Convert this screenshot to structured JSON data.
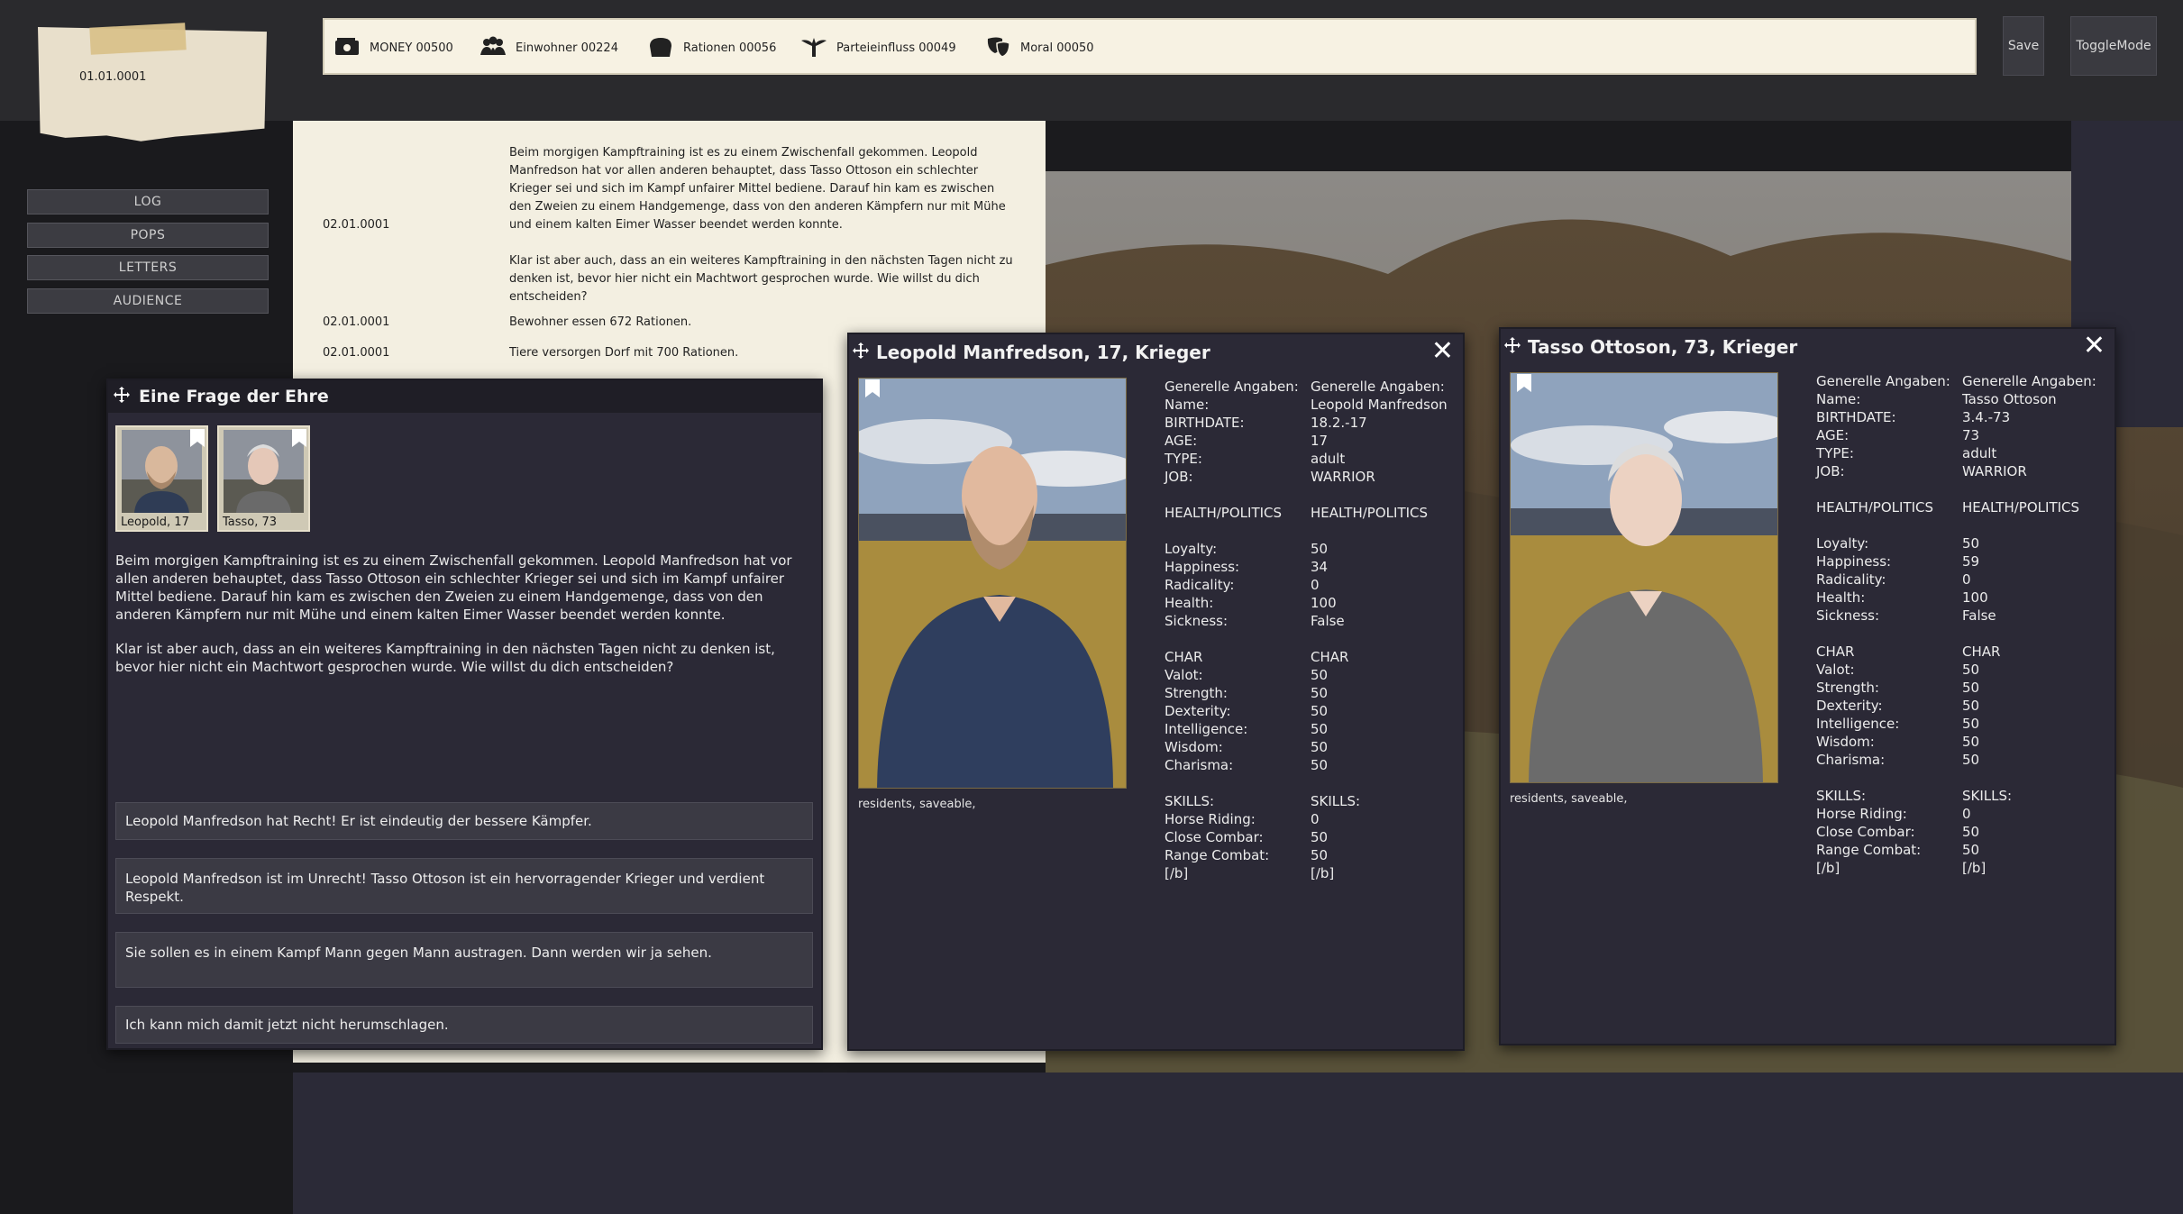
{
  "date": "01.01.0001",
  "resources": {
    "money": "MONEY  00500",
    "einwohner": "Einwohner  00224",
    "rationen": "Rationen  00056",
    "parteieinfluss": "Parteieinfluss  00049",
    "moral": "Moral  00050"
  },
  "buttons": {
    "save": "Save",
    "toggle": "ToggleMode"
  },
  "menu": [
    "LOG",
    "POPS",
    "LETTERS",
    "AUDIENCE"
  ],
  "log": [
    {
      "date": "02.01.0001",
      "text": "Beim morgigen Kampftraining ist es zu einem Zwischenfall gekommen. Leopold Manfredson hat vor allen anderen behauptet, dass Tasso Ottoson ein schlechter Krieger sei und sich im Kampf unfairer Mittel bediene. Darauf hin kam es zwischen den Zweien zu einem Handgemenge, dass von den anderen Kämpfern nur mit Mühe und einem kalten Eimer Wasser beendet werden konnte.",
      "text2": "Klar ist aber auch, dass an ein weiteres Kampftraining in den nächsten Tagen nicht zu denken ist, bevor hier nicht ein Machtwort gesprochen wurde. Wie willst du dich entscheiden?"
    },
    {
      "date": "02.01.0001",
      "text": "Bewohner essen 672 Rationen."
    },
    {
      "date": "02.01.0001",
      "text": "Tiere versorgen Dorf mit 700 Rationen."
    }
  ],
  "event": {
    "title": "Eine Frage der Ehre",
    "portraits": [
      {
        "label": "Leopold, 17"
      },
      {
        "label": "Tasso, 73"
      }
    ],
    "text1": "Beim morgigen Kampftraining ist es zu einem Zwischenfall gekommen. Leopold Manfredson hat vor allen anderen behauptet, dass Tasso Ottoson ein schlechter Krieger sei und sich im Kampf unfairer Mittel bediene. Darauf hin kam es zwischen den Zweien zu einem Handgemenge, dass von den anderen Kämpfern nur mit Mühe und einem kalten Eimer Wasser beendet werden konnte.",
    "text2": "Klar ist aber auch, dass an ein weiteres Kampftraining in den nächsten Tagen nicht zu denken ist, bevor hier nicht ein Machtwort gesprochen wurde. Wie willst du dich entscheiden?",
    "choices": [
      "Leopold Manfredson hat Recht! Er ist eindeutig der bessere Kämpfer.",
      "Leopold Manfredson  ist im Unrecht! Tasso Ottoson ist ein hervorragender Krieger und verdient Respekt.",
      "Sie sollen es in einem Kampf Mann gegen Mann austragen. Dann werden wir ja sehen.",
      "Ich kann mich damit jetzt nicht herumschlagen."
    ]
  },
  "cards": [
    {
      "title": "Leopold Manfredson, 17, Krieger",
      "tags": "residents, saveable,",
      "labels": [
        "Generelle Angaben:",
        "Name:",
        "BIRTHDATE:",
        "AGE:",
        "TYPE:",
        "JOB:",
        "",
        "HEALTH/POLITICS",
        "",
        "Loyalty:",
        "Happiness:",
        "Radicality:",
        "Health:",
        "Sickness:",
        "",
        "CHAR",
        "Valot:",
        "Strength:",
        "Dexterity:",
        "Intelligence:",
        "Wisdom:",
        "Charisma:",
        "",
        "SKILLS:",
        "Horse Riding:",
        "Close Combar:",
        "Range Combat:",
        "[/b]"
      ],
      "values": [
        "Generelle Angaben:",
        "Leopold Manfredson",
        "18.2.-17",
        "17",
        "adult",
        "WARRIOR",
        "",
        "HEALTH/POLITICS",
        "",
        "50",
        "34",
        "0",
        "100",
        "False",
        "",
        "CHAR",
        "50",
        "50",
        "50",
        "50",
        "50",
        "50",
        "",
        "SKILLS:",
        "0",
        "50",
        "50",
        "[/b]"
      ]
    },
    {
      "title": "Tasso Ottoson, 73, Krieger",
      "tags": "residents, saveable,",
      "labels": [
        "Generelle Angaben:",
        "Name:",
        "BIRTHDATE:",
        "AGE:",
        "TYPE:",
        "JOB:",
        "",
        "HEALTH/POLITICS",
        "",
        "Loyalty:",
        "Happiness:",
        "Radicality:",
        "Health:",
        "Sickness:",
        "",
        "CHAR",
        "Valot:",
        "Strength:",
        "Dexterity:",
        "Intelligence:",
        "Wisdom:",
        "Charisma:",
        "",
        "SKILLS:",
        "Horse Riding:",
        "Close Combar:",
        "Range Combat:",
        "[/b]"
      ],
      "values": [
        "Generelle Angaben:",
        "Tasso Ottoson",
        "3.4.-73",
        "73",
        "adult",
        "WARRIOR",
        "",
        "HEALTH/POLITICS",
        "",
        "50",
        "59",
        "0",
        "100",
        "False",
        "",
        "CHAR",
        "50",
        "50",
        "50",
        "50",
        "50",
        "50",
        "",
        "SKILLS:",
        "0",
        "50",
        "50",
        "[/b]"
      ]
    }
  ],
  "icons": {
    "money": "money-icon",
    "einwohner": "people-icon",
    "rationen": "bread-icon",
    "parteieinfluss": "eagle-icon",
    "moral": "masks-icon",
    "move": "move-icon",
    "close": "close-icon",
    "bookmark": "bookmark-icon"
  }
}
